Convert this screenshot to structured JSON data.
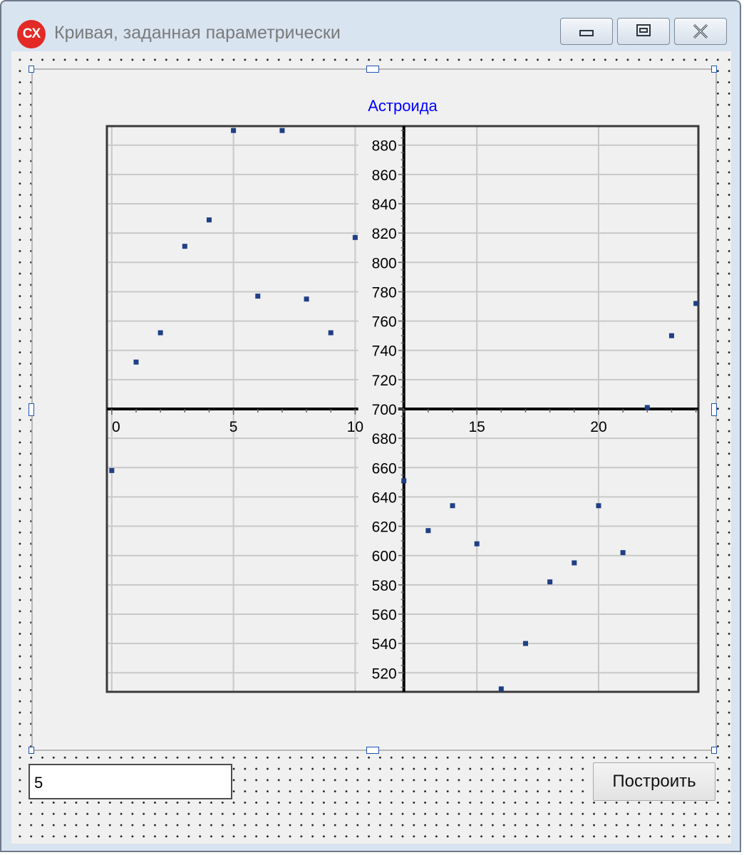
{
  "window": {
    "title": "Кривая, заданная параметрически",
    "app_icon_label": "CX"
  },
  "controls": {
    "input_value": "5",
    "build_button_label": "Построить"
  },
  "colors": {
    "title_color": "#0000ff",
    "marker_color": "#1f3f86",
    "grid_color": "#c8c8c8",
    "axis_color": "#000000"
  },
  "chart_data": {
    "type": "scatter",
    "title": "Астроида",
    "xlabel": "",
    "ylabel": "",
    "xlim": [
      -0.2,
      24.1
    ],
    "ylim": [
      507,
      893
    ],
    "xticks": [
      0,
      5,
      10,
      15,
      20
    ],
    "yticks": [
      520,
      540,
      560,
      580,
      600,
      620,
      640,
      660,
      680,
      700,
      720,
      740,
      760,
      780,
      800,
      820,
      840,
      860,
      880
    ],
    "grid": true,
    "legend": "none",
    "series": [
      {
        "x": [
          0,
          1,
          2,
          3,
          4,
          5,
          6,
          7,
          8,
          9,
          10,
          12,
          13,
          14,
          15,
          16,
          17,
          18,
          19,
          20,
          21,
          22,
          23,
          24
        ],
        "y": [
          658,
          732,
          752,
          811,
          829,
          890,
          777,
          890,
          775,
          752,
          817,
          651,
          617,
          634,
          608,
          509,
          540,
          582,
          595,
          634,
          602,
          701,
          750,
          772
        ]
      }
    ]
  }
}
